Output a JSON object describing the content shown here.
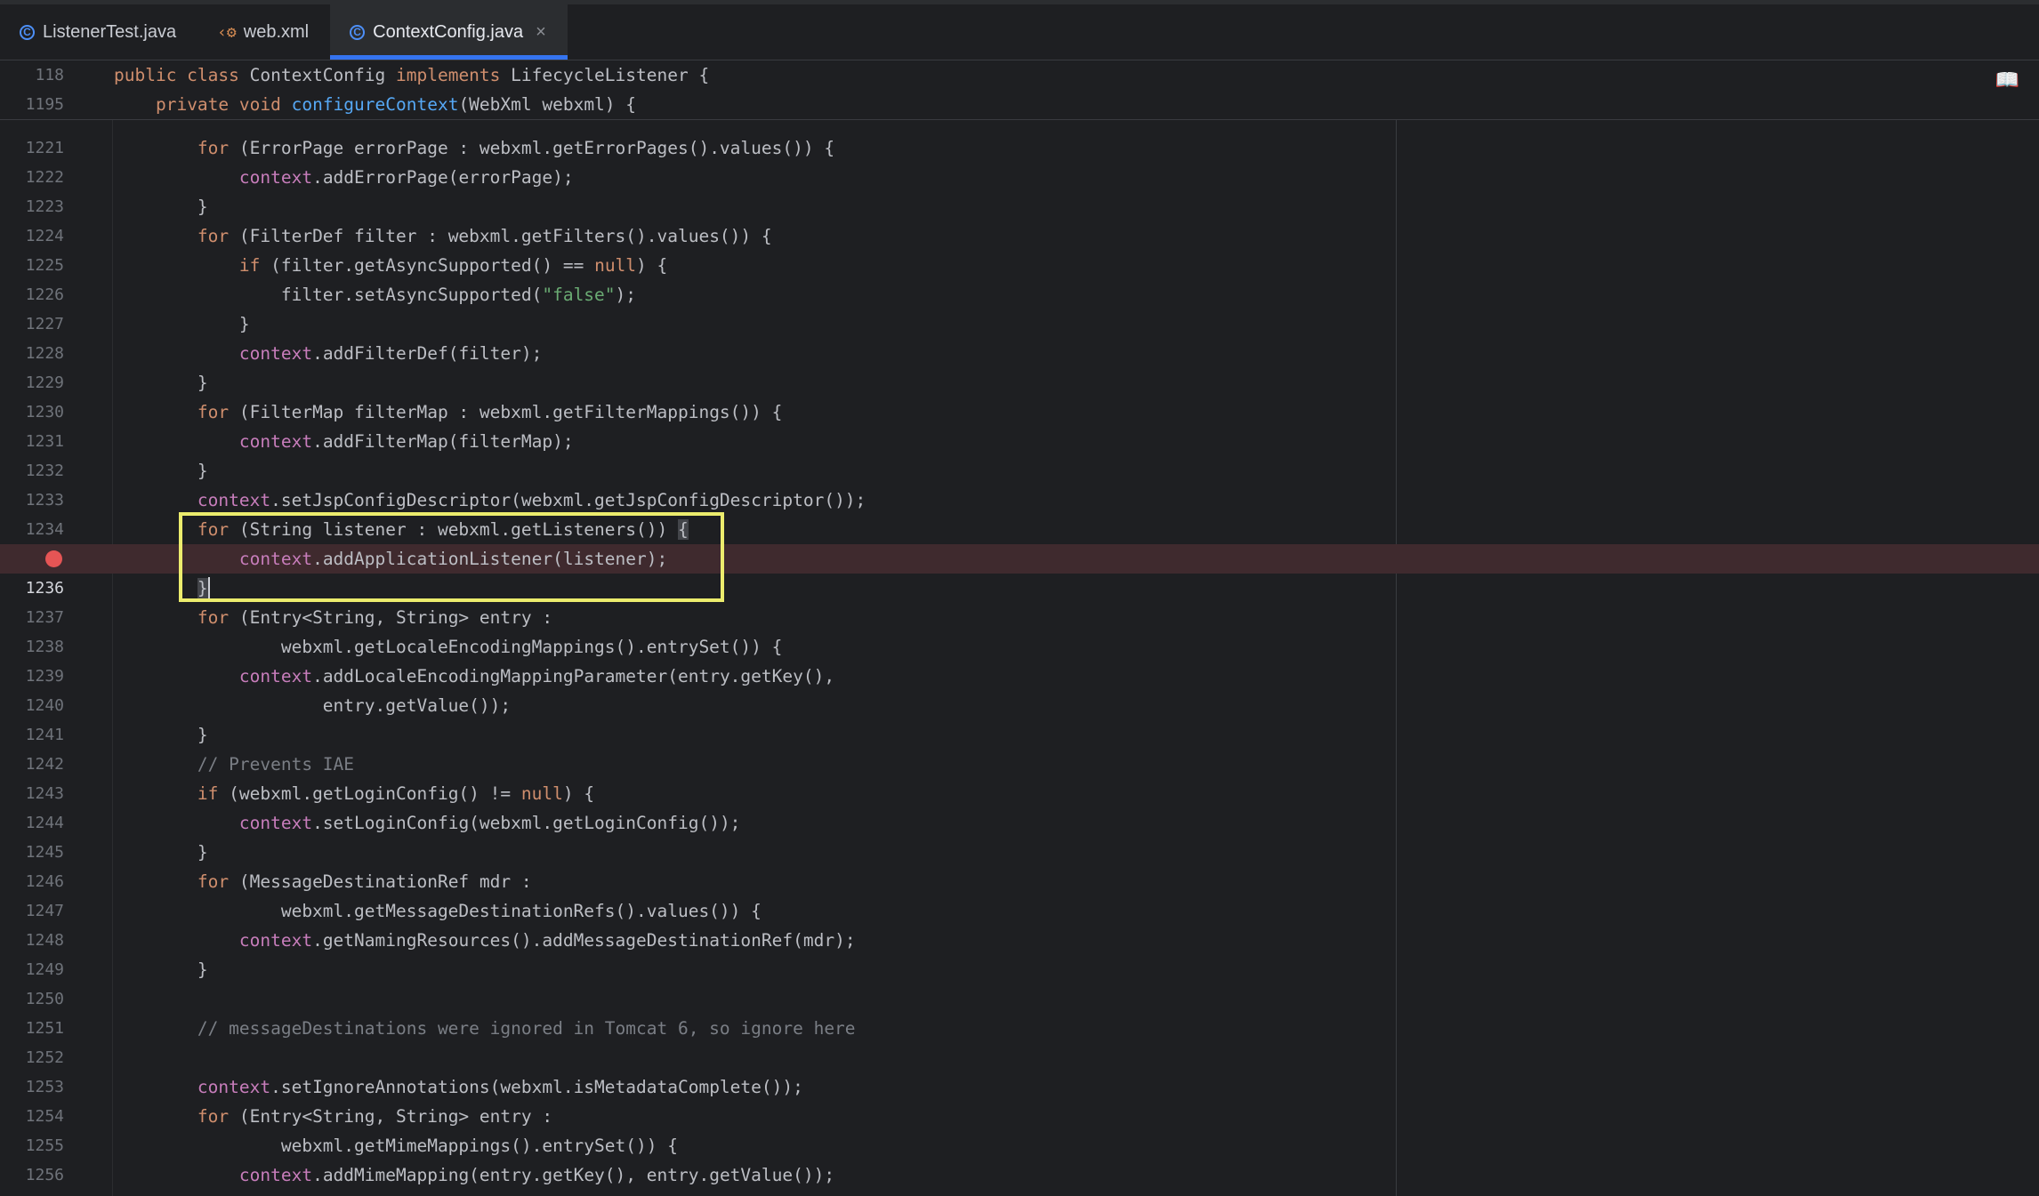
{
  "tabs": [
    {
      "label": "ListenerTest.java",
      "icon": "class-icon",
      "active": false
    },
    {
      "label": "web.xml",
      "icon": "xml-file-icon",
      "active": false
    },
    {
      "label": "ContextConfig.java",
      "icon": "class-icon",
      "active": true,
      "close": "×"
    }
  ],
  "sticky": [
    {
      "ln": "118",
      "tokens": [
        [
          "k",
          "public class "
        ],
        [
          "t",
          "ContextConfig "
        ],
        [
          "k",
          "implements "
        ],
        [
          "t",
          "LifecycleListener {"
        ]
      ]
    },
    {
      "ln": "1195",
      "tokens": [
        [
          "t",
          "    "
        ],
        [
          "k",
          "private void "
        ],
        [
          "f",
          "configureContext"
        ],
        [
          "t",
          "(WebXml webxml) {"
        ]
      ]
    }
  ],
  "lines": [
    {
      "ln": "1221",
      "tokens": [
        [
          "t",
          "        "
        ],
        [
          "k",
          "for "
        ],
        [
          "t",
          "(ErrorPage errorPage : webxml.getErrorPages().values()) {"
        ]
      ]
    },
    {
      "ln": "1222",
      "tokens": [
        [
          "t",
          "            "
        ],
        [
          "p",
          "context"
        ],
        [
          "t",
          ".addErrorPage(errorPage);"
        ]
      ]
    },
    {
      "ln": "1223",
      "tokens": [
        [
          "t",
          "        }"
        ]
      ]
    },
    {
      "ln": "1224",
      "tokens": [
        [
          "t",
          "        "
        ],
        [
          "k",
          "for "
        ],
        [
          "t",
          "(FilterDef filter : webxml.getFilters().values()) {"
        ]
      ]
    },
    {
      "ln": "1225",
      "tokens": [
        [
          "t",
          "            "
        ],
        [
          "k",
          "if "
        ],
        [
          "t",
          "(filter.getAsyncSupported() == "
        ],
        [
          "k",
          "null"
        ],
        [
          "t",
          ") {"
        ]
      ]
    },
    {
      "ln": "1226",
      "tokens": [
        [
          "t",
          "                filter.setAsyncSupported("
        ],
        [
          "s",
          "\"false\""
        ],
        [
          "t",
          ");"
        ]
      ]
    },
    {
      "ln": "1227",
      "tokens": [
        [
          "t",
          "            }"
        ]
      ]
    },
    {
      "ln": "1228",
      "tokens": [
        [
          "t",
          "            "
        ],
        [
          "p",
          "context"
        ],
        [
          "t",
          ".addFilterDef(filter);"
        ]
      ]
    },
    {
      "ln": "1229",
      "tokens": [
        [
          "t",
          "        }"
        ]
      ]
    },
    {
      "ln": "1230",
      "tokens": [
        [
          "t",
          "        "
        ],
        [
          "k",
          "for "
        ],
        [
          "t",
          "(FilterMap filterMap : webxml.getFilterMappings()) {"
        ]
      ]
    },
    {
      "ln": "1231",
      "tokens": [
        [
          "t",
          "            "
        ],
        [
          "p",
          "context"
        ],
        [
          "t",
          ".addFilterMap(filterMap);"
        ]
      ]
    },
    {
      "ln": "1232",
      "tokens": [
        [
          "t",
          "        }"
        ]
      ]
    },
    {
      "ln": "1233",
      "tokens": [
        [
          "t",
          "        "
        ],
        [
          "p",
          "context"
        ],
        [
          "t",
          ".setJspConfigDescriptor(webxml.getJspConfigDescriptor());"
        ]
      ]
    },
    {
      "ln": "1234",
      "tokens": [
        [
          "t",
          "        "
        ],
        [
          "k",
          "for "
        ],
        [
          "t",
          "(String listener : webxml.getListeners()) "
        ],
        [
          "bh",
          "{"
        ]
      ]
    },
    {
      "ln": "",
      "breakpoint": true,
      "tokens": [
        [
          "t",
          "            "
        ],
        [
          "p",
          "context"
        ],
        [
          "t",
          ".addApplicationListener(listener);"
        ]
      ]
    },
    {
      "ln": "1236",
      "current": true,
      "tokens": [
        [
          "t",
          "        "
        ],
        [
          "bh",
          "}"
        ],
        [
          "caret",
          ""
        ]
      ]
    },
    {
      "ln": "1237",
      "tokens": [
        [
          "t",
          "        "
        ],
        [
          "k",
          "for "
        ],
        [
          "t",
          "(Entry<String, String> entry :"
        ]
      ]
    },
    {
      "ln": "1238",
      "tokens": [
        [
          "t",
          "                webxml.getLocaleEncodingMappings().entrySet()) {"
        ]
      ]
    },
    {
      "ln": "1239",
      "tokens": [
        [
          "t",
          "            "
        ],
        [
          "p",
          "context"
        ],
        [
          "t",
          ".addLocaleEncodingMappingParameter(entry.getKey(),"
        ]
      ]
    },
    {
      "ln": "1240",
      "tokens": [
        [
          "t",
          "                    entry.getValue());"
        ]
      ]
    },
    {
      "ln": "1241",
      "tokens": [
        [
          "t",
          "        }"
        ]
      ]
    },
    {
      "ln": "1242",
      "tokens": [
        [
          "t",
          "        "
        ],
        [
          "c",
          "// Prevents IAE"
        ]
      ]
    },
    {
      "ln": "1243",
      "tokens": [
        [
          "t",
          "        "
        ],
        [
          "k",
          "if "
        ],
        [
          "t",
          "(webxml.getLoginConfig() != "
        ],
        [
          "k",
          "null"
        ],
        [
          "t",
          ") {"
        ]
      ]
    },
    {
      "ln": "1244",
      "tokens": [
        [
          "t",
          "            "
        ],
        [
          "p",
          "context"
        ],
        [
          "t",
          ".setLoginConfig(webxml.getLoginConfig());"
        ]
      ]
    },
    {
      "ln": "1245",
      "tokens": [
        [
          "t",
          "        }"
        ]
      ]
    },
    {
      "ln": "1246",
      "tokens": [
        [
          "t",
          "        "
        ],
        [
          "k",
          "for "
        ],
        [
          "t",
          "(MessageDestinationRef mdr :"
        ]
      ]
    },
    {
      "ln": "1247",
      "tokens": [
        [
          "t",
          "                webxml.getMessageDestinationRefs().values()) {"
        ]
      ]
    },
    {
      "ln": "1248",
      "tokens": [
        [
          "t",
          "            "
        ],
        [
          "p",
          "context"
        ],
        [
          "t",
          ".getNamingResources().addMessageDestinationRef(mdr);"
        ]
      ]
    },
    {
      "ln": "1249",
      "tokens": [
        [
          "t",
          "        }"
        ]
      ]
    },
    {
      "ln": "1250",
      "tokens": []
    },
    {
      "ln": "1251",
      "tokens": [
        [
          "t",
          "        "
        ],
        [
          "c",
          "// messageDestinations were ignored in Tomcat 6, so ignore here"
        ]
      ]
    },
    {
      "ln": "1252",
      "tokens": []
    },
    {
      "ln": "1253",
      "tokens": [
        [
          "t",
          "        "
        ],
        [
          "p",
          "context"
        ],
        [
          "t",
          ".setIgnoreAnnotations(webxml.isMetadataComplete());"
        ]
      ]
    },
    {
      "ln": "1254",
      "tokens": [
        [
          "t",
          "        "
        ],
        [
          "k",
          "for "
        ],
        [
          "t",
          "(Entry<String, String> entry :"
        ]
      ]
    },
    {
      "ln": "1255",
      "tokens": [
        [
          "t",
          "                webxml.getMimeMappings().entrySet()) {"
        ]
      ]
    },
    {
      "ln": "1256",
      "tokens": [
        [
          "t",
          "            "
        ],
        [
          "p",
          "context"
        ],
        [
          "t",
          ".addMimeMapping(entry.getKey(), entry.getValue());"
        ]
      ]
    }
  ],
  "colors": {
    "background": "#1e1f22",
    "keyword": "#cf8e6d",
    "method_decl": "#56a8f5",
    "string": "#6aab73",
    "comment": "#7a7e85",
    "field": "#c77dbb",
    "breakpoint": "#e55555",
    "highlight_box": "#ecec6d",
    "tab_accent": "#3574f0"
  }
}
